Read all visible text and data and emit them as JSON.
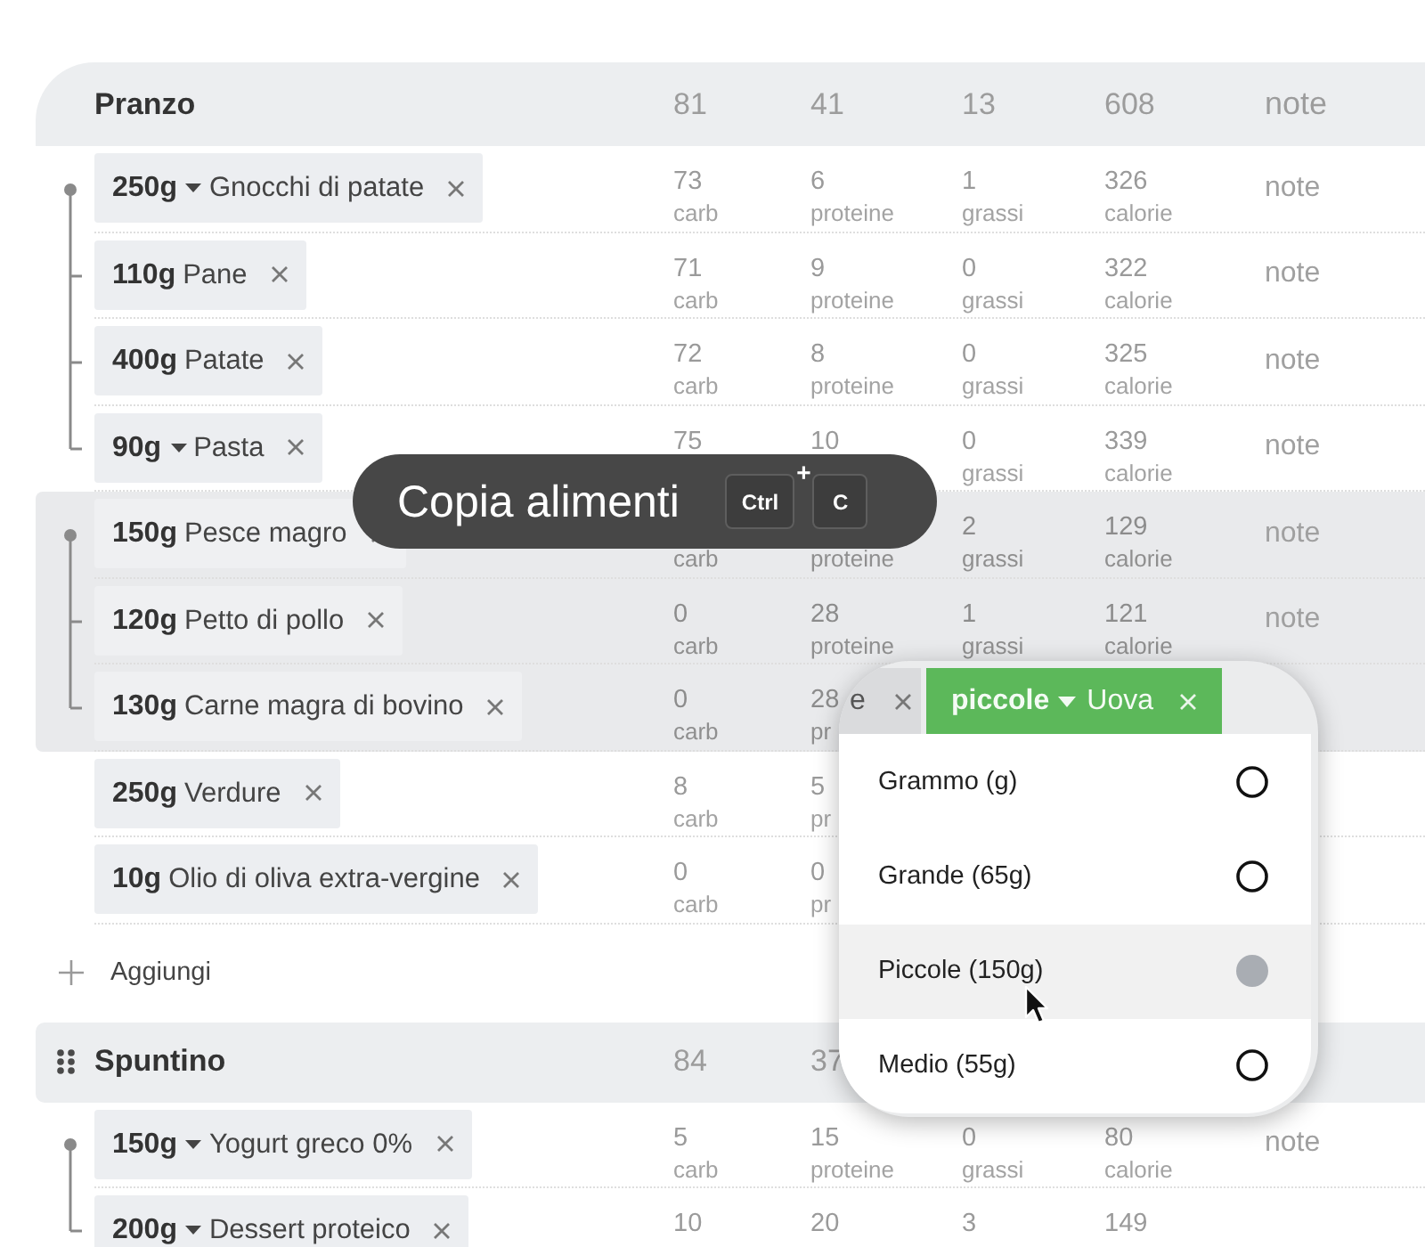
{
  "meals": [
    {
      "name": "Pranzo",
      "drag_handle": false,
      "totals": {
        "carb": "81",
        "proteine": "41",
        "grassi": "13",
        "calorie": "608",
        "note": "note"
      },
      "groups": [
        {
          "selected": false,
          "items": [
            {
              "amount": "250g",
              "unit_menu": true,
              "name": "Gnocchi di patate",
              "carb": {
                "value": "73",
                "unit": "carb"
              },
              "proteine": {
                "value": "6",
                "unit": "proteine"
              },
              "grassi": {
                "value": "1",
                "unit": "grassi"
              },
              "calorie": {
                "value": "326",
                "unit": "calorie"
              },
              "note": "note"
            },
            {
              "amount": "110g",
              "unit_menu": false,
              "name": "Pane",
              "carb": {
                "value": "71",
                "unit": "carb"
              },
              "proteine": {
                "value": "9",
                "unit": "proteine"
              },
              "grassi": {
                "value": "0",
                "unit": "grassi"
              },
              "calorie": {
                "value": "322",
                "unit": "calorie"
              },
              "note": "note"
            },
            {
              "amount": "400g",
              "unit_menu": false,
              "name": "Patate",
              "carb": {
                "value": "72",
                "unit": "carb"
              },
              "proteine": {
                "value": "8",
                "unit": "proteine"
              },
              "grassi": {
                "value": "0",
                "unit": "grassi"
              },
              "calorie": {
                "value": "325",
                "unit": "calorie"
              },
              "note": "note"
            },
            {
              "amount": "90g",
              "unit_menu": true,
              "name": "Pasta",
              "carb": {
                "value": "75"
              },
              "proteine": {
                "value": "10"
              },
              "grassi": {
                "value": "0",
                "unit": "grassi"
              },
              "calorie": {
                "value": "339",
                "unit": "calorie"
              },
              "note": "note"
            }
          ]
        },
        {
          "selected": true,
          "items": [
            {
              "amount": "150g",
              "unit_menu": false,
              "name": "Pesce magro",
              "carb": {
                "unit": "carb"
              },
              "proteine": {
                "unit": "proteine"
              },
              "grassi": {
                "value": "2",
                "unit": "grassi"
              },
              "calorie": {
                "value": "129",
                "unit": "calorie"
              },
              "note": "note"
            },
            {
              "amount": "120g",
              "unit_menu": false,
              "name": "Petto di pollo",
              "carb": {
                "value": "0",
                "unit": "carb"
              },
              "proteine": {
                "value": "28",
                "unit": "proteine"
              },
              "grassi": {
                "value": "1",
                "unit": "grassi"
              },
              "calorie": {
                "value": "121",
                "unit": "calorie"
              },
              "note": "note"
            },
            {
              "amount": "130g",
              "unit_menu": false,
              "name": "Carne magra di bovino",
              "carb": {
                "value": "0",
                "unit": "carb"
              },
              "proteine": {
                "value": "28",
                "unit": "pr"
              }
            }
          ]
        },
        {
          "selected": false,
          "items": [
            {
              "amount": "250g",
              "unit_menu": false,
              "name": "Verdure",
              "carb": {
                "value": "8",
                "unit": "carb"
              },
              "proteine": {
                "value": "5",
                "unit": "pr"
              }
            }
          ]
        },
        {
          "selected": false,
          "items": [
            {
              "amount": "10g",
              "unit_menu": false,
              "name": "Olio di oliva extra-vergine",
              "carb": {
                "value": "0",
                "unit": "carb"
              },
              "proteine": {
                "value": "0",
                "unit": "pr"
              }
            }
          ]
        }
      ],
      "add_label": "Aggiungi"
    },
    {
      "name": "Spuntino",
      "drag_handle": true,
      "totals": {
        "carb": "84",
        "proteine": "37"
      },
      "groups": [
        {
          "selected": false,
          "items": [
            {
              "amount": "150g",
              "unit_menu": true,
              "name": "Yogurt greco 0%",
              "carb": {
                "value": "5",
                "unit": "carb"
              },
              "proteine": {
                "value": "15",
                "unit": "proteine"
              },
              "grassi": {
                "value": "0",
                "unit": "grassi"
              },
              "calorie": {
                "value": "80",
                "unit": "calorie"
              },
              "note": "note"
            },
            {
              "amount": "200g",
              "unit_menu": true,
              "name": "Dessert proteico",
              "carb": {
                "value": "10"
              },
              "proteine": {
                "value": "20"
              },
              "grassi": {
                "value": "3"
              },
              "calorie": {
                "value": "149"
              }
            }
          ]
        }
      ]
    }
  ],
  "toast": {
    "label": "Copia alimenti",
    "keys": [
      "Ctrl",
      "C"
    ],
    "joiner": "+"
  },
  "unit_popup": {
    "chip_fragment": {
      "name": "e"
    },
    "chip": {
      "amount": "piccole",
      "unit_menu": true,
      "name": "Uova"
    },
    "options": [
      {
        "label": "Grammo (g)",
        "selected": false,
        "hovered": false
      },
      {
        "label": "Grande (65g)",
        "selected": false,
        "hovered": false
      },
      {
        "label": "Piccole (150g)",
        "selected": true,
        "hovered": true
      },
      {
        "label": "Medio (55g)",
        "selected": false,
        "hovered": false
      }
    ]
  }
}
